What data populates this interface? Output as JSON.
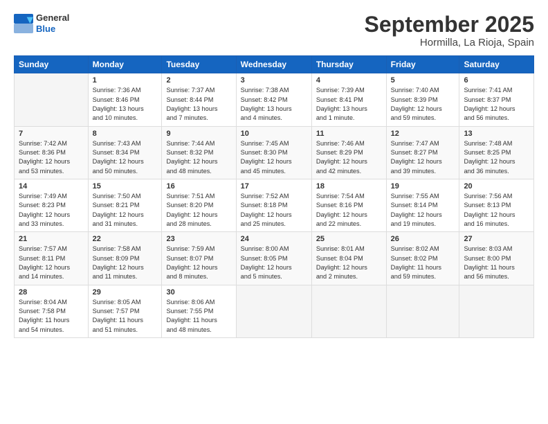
{
  "logo": {
    "general": "General",
    "blue": "Blue"
  },
  "title": "September 2025",
  "location": "Hormilla, La Rioja, Spain",
  "weekdays": [
    "Sunday",
    "Monday",
    "Tuesday",
    "Wednesday",
    "Thursday",
    "Friday",
    "Saturday"
  ],
  "weeks": [
    [
      {
        "day": "",
        "info": ""
      },
      {
        "day": "1",
        "info": "Sunrise: 7:36 AM\nSunset: 8:46 PM\nDaylight: 13 hours\nand 10 minutes."
      },
      {
        "day": "2",
        "info": "Sunrise: 7:37 AM\nSunset: 8:44 PM\nDaylight: 13 hours\nand 7 minutes."
      },
      {
        "day": "3",
        "info": "Sunrise: 7:38 AM\nSunset: 8:42 PM\nDaylight: 13 hours\nand 4 minutes."
      },
      {
        "day": "4",
        "info": "Sunrise: 7:39 AM\nSunset: 8:41 PM\nDaylight: 13 hours\nand 1 minute."
      },
      {
        "day": "5",
        "info": "Sunrise: 7:40 AM\nSunset: 8:39 PM\nDaylight: 12 hours\nand 59 minutes."
      },
      {
        "day": "6",
        "info": "Sunrise: 7:41 AM\nSunset: 8:37 PM\nDaylight: 12 hours\nand 56 minutes."
      }
    ],
    [
      {
        "day": "7",
        "info": "Sunrise: 7:42 AM\nSunset: 8:36 PM\nDaylight: 12 hours\nand 53 minutes."
      },
      {
        "day": "8",
        "info": "Sunrise: 7:43 AM\nSunset: 8:34 PM\nDaylight: 12 hours\nand 50 minutes."
      },
      {
        "day": "9",
        "info": "Sunrise: 7:44 AM\nSunset: 8:32 PM\nDaylight: 12 hours\nand 48 minutes."
      },
      {
        "day": "10",
        "info": "Sunrise: 7:45 AM\nSunset: 8:30 PM\nDaylight: 12 hours\nand 45 minutes."
      },
      {
        "day": "11",
        "info": "Sunrise: 7:46 AM\nSunset: 8:29 PM\nDaylight: 12 hours\nand 42 minutes."
      },
      {
        "day": "12",
        "info": "Sunrise: 7:47 AM\nSunset: 8:27 PM\nDaylight: 12 hours\nand 39 minutes."
      },
      {
        "day": "13",
        "info": "Sunrise: 7:48 AM\nSunset: 8:25 PM\nDaylight: 12 hours\nand 36 minutes."
      }
    ],
    [
      {
        "day": "14",
        "info": "Sunrise: 7:49 AM\nSunset: 8:23 PM\nDaylight: 12 hours\nand 33 minutes."
      },
      {
        "day": "15",
        "info": "Sunrise: 7:50 AM\nSunset: 8:21 PM\nDaylight: 12 hours\nand 31 minutes."
      },
      {
        "day": "16",
        "info": "Sunrise: 7:51 AM\nSunset: 8:20 PM\nDaylight: 12 hours\nand 28 minutes."
      },
      {
        "day": "17",
        "info": "Sunrise: 7:52 AM\nSunset: 8:18 PM\nDaylight: 12 hours\nand 25 minutes."
      },
      {
        "day": "18",
        "info": "Sunrise: 7:54 AM\nSunset: 8:16 PM\nDaylight: 12 hours\nand 22 minutes."
      },
      {
        "day": "19",
        "info": "Sunrise: 7:55 AM\nSunset: 8:14 PM\nDaylight: 12 hours\nand 19 minutes."
      },
      {
        "day": "20",
        "info": "Sunrise: 7:56 AM\nSunset: 8:13 PM\nDaylight: 12 hours\nand 16 minutes."
      }
    ],
    [
      {
        "day": "21",
        "info": "Sunrise: 7:57 AM\nSunset: 8:11 PM\nDaylight: 12 hours\nand 14 minutes."
      },
      {
        "day": "22",
        "info": "Sunrise: 7:58 AM\nSunset: 8:09 PM\nDaylight: 12 hours\nand 11 minutes."
      },
      {
        "day": "23",
        "info": "Sunrise: 7:59 AM\nSunset: 8:07 PM\nDaylight: 12 hours\nand 8 minutes."
      },
      {
        "day": "24",
        "info": "Sunrise: 8:00 AM\nSunset: 8:05 PM\nDaylight: 12 hours\nand 5 minutes."
      },
      {
        "day": "25",
        "info": "Sunrise: 8:01 AM\nSunset: 8:04 PM\nDaylight: 12 hours\nand 2 minutes."
      },
      {
        "day": "26",
        "info": "Sunrise: 8:02 AM\nSunset: 8:02 PM\nDaylight: 11 hours\nand 59 minutes."
      },
      {
        "day": "27",
        "info": "Sunrise: 8:03 AM\nSunset: 8:00 PM\nDaylight: 11 hours\nand 56 minutes."
      }
    ],
    [
      {
        "day": "28",
        "info": "Sunrise: 8:04 AM\nSunset: 7:58 PM\nDaylight: 11 hours\nand 54 minutes."
      },
      {
        "day": "29",
        "info": "Sunrise: 8:05 AM\nSunset: 7:57 PM\nDaylight: 11 hours\nand 51 minutes."
      },
      {
        "day": "30",
        "info": "Sunrise: 8:06 AM\nSunset: 7:55 PM\nDaylight: 11 hours\nand 48 minutes."
      },
      {
        "day": "",
        "info": ""
      },
      {
        "day": "",
        "info": ""
      },
      {
        "day": "",
        "info": ""
      },
      {
        "day": "",
        "info": ""
      }
    ]
  ]
}
